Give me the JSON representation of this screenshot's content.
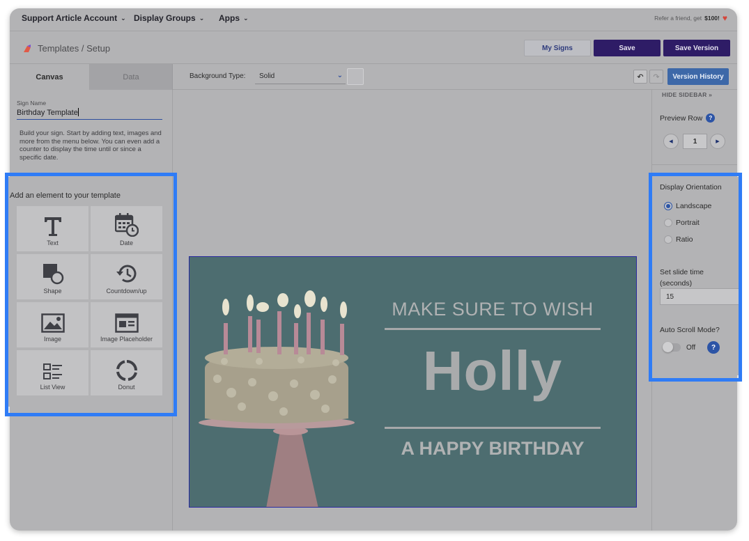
{
  "topnav": {
    "account": "Support Article Account",
    "display_groups": "Display Groups",
    "apps": "Apps",
    "refer_prefix": "Refer a friend, get",
    "refer_amount": "$100!"
  },
  "titlebar": {
    "breadcrumb": "Templates / Setup",
    "my_signs": "My Signs",
    "save": "Save",
    "save_version": "Save Version"
  },
  "tabs": {
    "canvas": "Canvas",
    "data": "Data"
  },
  "toolbar": {
    "background_type_label": "Background Type:",
    "background_type_value": "Solid",
    "version_history": "Version History"
  },
  "left": {
    "sign_name_label": "Sign Name",
    "sign_name_value": "Birthday Template",
    "help_text": "Build your sign. Start by adding text, images and more from the menu below. You can even add a counter to display the time until or since a specific date.",
    "add_title": "Add an element to your template",
    "elements": [
      {
        "label": "Text",
        "icon": "text-icon"
      },
      {
        "label": "Date",
        "icon": "calendar-clock-icon"
      },
      {
        "label": "Shape",
        "icon": "shape-icon"
      },
      {
        "label": "Countdown/up",
        "icon": "history-icon"
      },
      {
        "label": "Image",
        "icon": "image-icon"
      },
      {
        "label": "Image Placeholder",
        "icon": "image-placeholder-icon"
      },
      {
        "label": "List View",
        "icon": "list-view-icon"
      },
      {
        "label": "Donut",
        "icon": "donut-icon"
      }
    ]
  },
  "preview": {
    "line1": "MAKE SURE TO WISH",
    "name": "Holly",
    "line2": "A HAPPY BIRTHDAY",
    "background_color": "#4d6d70"
  },
  "sidebar": {
    "hide_sidebar": "HIDE SIDEBAR »",
    "preview_row_label": "Preview Row",
    "preview_row_value": "1",
    "orientation_title": "Display Orientation",
    "orientations": [
      "Landscape",
      "Portrait",
      "Ratio"
    ],
    "selected_orientation": "Landscape",
    "slide_time_label": "Set slide time (seconds)",
    "slide_time_value": "15",
    "auto_scroll_label": "Auto Scroll Mode?",
    "auto_scroll_state": "Off"
  },
  "colors": {
    "primary": "#2e1c66",
    "accent_blue": "#3d68a8",
    "highlight": "#2f7cf6",
    "heart": "#d4453a"
  }
}
